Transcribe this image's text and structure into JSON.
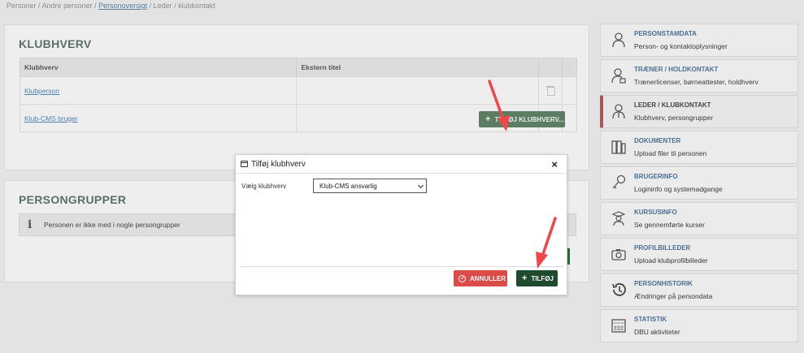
{
  "breadcrumb": {
    "part1": "Personer / Andre personer / ",
    "link": "Personoversigt",
    "part2": " / Leder / klubkontakt"
  },
  "klubhverv": {
    "title": "KLUBHVERV",
    "columns": [
      "Klubhverv",
      "Ekstern titel"
    ],
    "rows": [
      {
        "name": "Klubperson",
        "ekstern": ""
      },
      {
        "name": "Klub-CMS bruger",
        "ekstern": ""
      }
    ],
    "add_button": "TILFØJ KLUBHVERV..."
  },
  "persongrupper": {
    "title": "PERSONGRUPPER",
    "info": "Personen er ikke med i nogle persongrupper"
  },
  "sidebar": {
    "items": [
      {
        "title": "PERSONSTAMDATA",
        "sub": "Person- og kontaktoplysninger",
        "icon": "person-icon"
      },
      {
        "title": "TRÆNER / HOLDKONTAKT",
        "sub": "Trænerlicenser, børneattester, holdhverv",
        "icon": "coach-icon"
      },
      {
        "title": "LEDER / KLUBKONTAKT",
        "sub": "Klubhverv, persongrupper",
        "icon": "leader-icon"
      },
      {
        "title": "DOKUMENTER",
        "sub": "Upload filer til personen",
        "icon": "documents-icon"
      },
      {
        "title": "BRUGERINFO",
        "sub": "Logininfo og systemadgange",
        "icon": "key-icon"
      },
      {
        "title": "KURSUSINFO",
        "sub": "Se gennemførte kurser",
        "icon": "graduate-icon"
      },
      {
        "title": "PROFILBILLEDER",
        "sub": "Upload klubprofilbilleder",
        "icon": "camera-icon"
      },
      {
        "title": "PERSONHISTORIK",
        "sub": "Ændringer på persondata",
        "icon": "history-icon"
      },
      {
        "title": "STATISTIK",
        "sub": "DBU aktiviteter",
        "icon": "calendar-icon"
      }
    ],
    "active_index": 2
  },
  "modal": {
    "title": "Tilføj klubhverv",
    "close": "×",
    "field_label": "Vælg klubhverv",
    "select_value": "Klub-CMS ansvarlig",
    "cancel_label": "ANNULLER",
    "add_label": "TILFØJ"
  },
  "colors": {
    "accent_green": "#5d7d62",
    "dark_green": "#1e4a2d",
    "cancel_red": "#db4b48",
    "link_blue": "#4e82b0",
    "arrow_red": "#f0464a",
    "active_marker": "#a9565a"
  }
}
